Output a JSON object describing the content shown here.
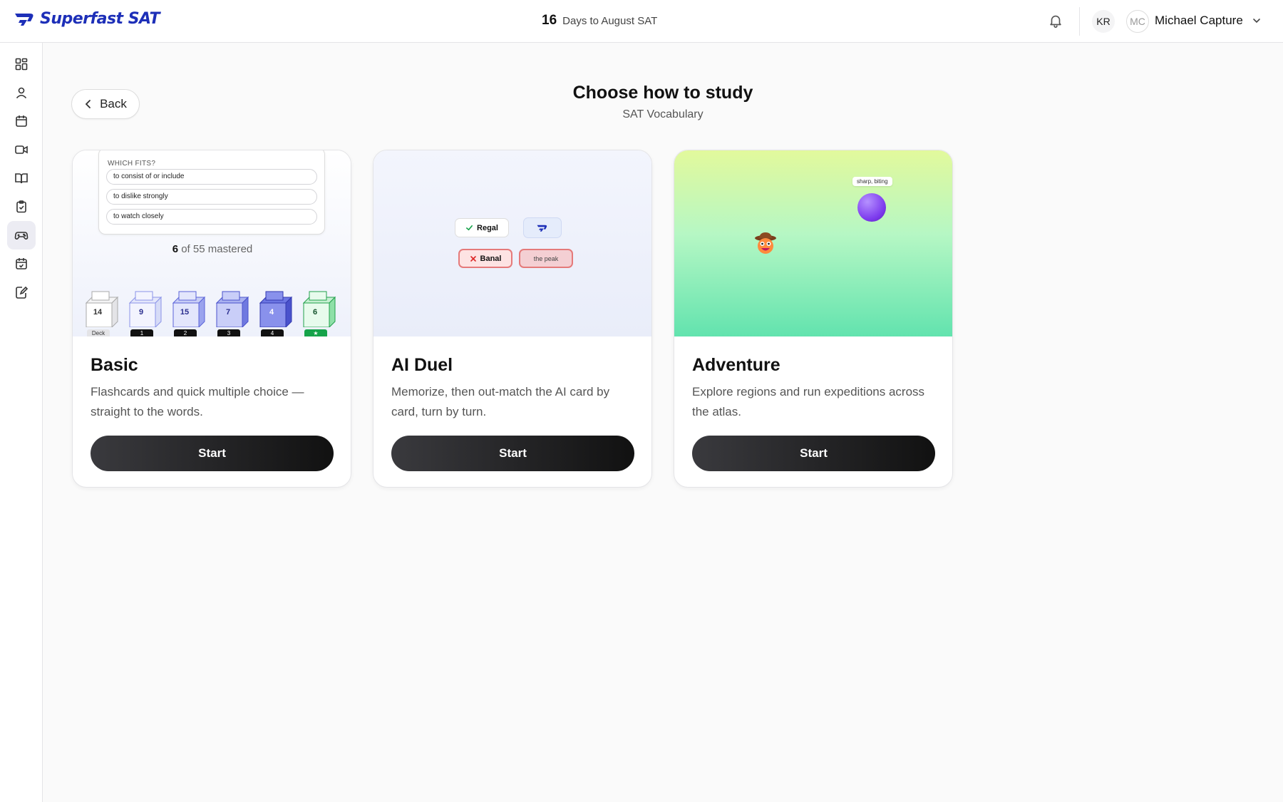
{
  "brand": {
    "name": "Superfast SAT",
    "color": "#1d2fb8"
  },
  "header": {
    "countdown_number": "16",
    "countdown_text": "Days to August SAT",
    "initials_kr": "KR",
    "initials_mc": "MC",
    "user_name": "Michael Capture"
  },
  "sidebar": {
    "items": [
      {
        "icon": "dashboard-icon"
      },
      {
        "icon": "profile-icon"
      },
      {
        "icon": "calendar-icon"
      },
      {
        "icon": "video-icon"
      },
      {
        "icon": "book-icon"
      },
      {
        "icon": "clipboard-check-icon"
      },
      {
        "icon": "gamepad-icon",
        "active": true
      },
      {
        "icon": "calendar-check-icon"
      },
      {
        "icon": "edit-note-icon"
      }
    ]
  },
  "page": {
    "back_label": "Back",
    "title": "Choose how to study",
    "subtitle": "SAT Vocabulary"
  },
  "cards": {
    "basic": {
      "title": "Basic",
      "description": "Flashcards and quick multiple choice — straight to the words.",
      "start": "Start",
      "preview": {
        "question_label": "WHICH FITS?",
        "options": [
          "to consist of or include",
          "to dislike strongly",
          "to watch closely"
        ],
        "mastered_count": "6",
        "mastered_text": "of 55 mastered",
        "boxes": [
          {
            "count": "14",
            "tag": "Deck"
          },
          {
            "count": "9",
            "tag": "1"
          },
          {
            "count": "15",
            "tag": "2"
          },
          {
            "count": "7",
            "tag": "3"
          },
          {
            "count": "4",
            "tag": "4"
          },
          {
            "count": "6",
            "tag": "★"
          }
        ]
      }
    },
    "duel": {
      "title": "AI Duel",
      "description": "Memorize, then out-match the AI card by card, turn by turn.",
      "start": "Start",
      "preview": {
        "correct_word": "Regal",
        "wrong_word": "Banal",
        "wrong_definition": "the peak"
      }
    },
    "adventure": {
      "title": "Adventure",
      "description": "Explore regions and run expeditions across the atlas.",
      "start": "Start",
      "preview": {
        "orb_label": "sharp, biting"
      }
    }
  }
}
